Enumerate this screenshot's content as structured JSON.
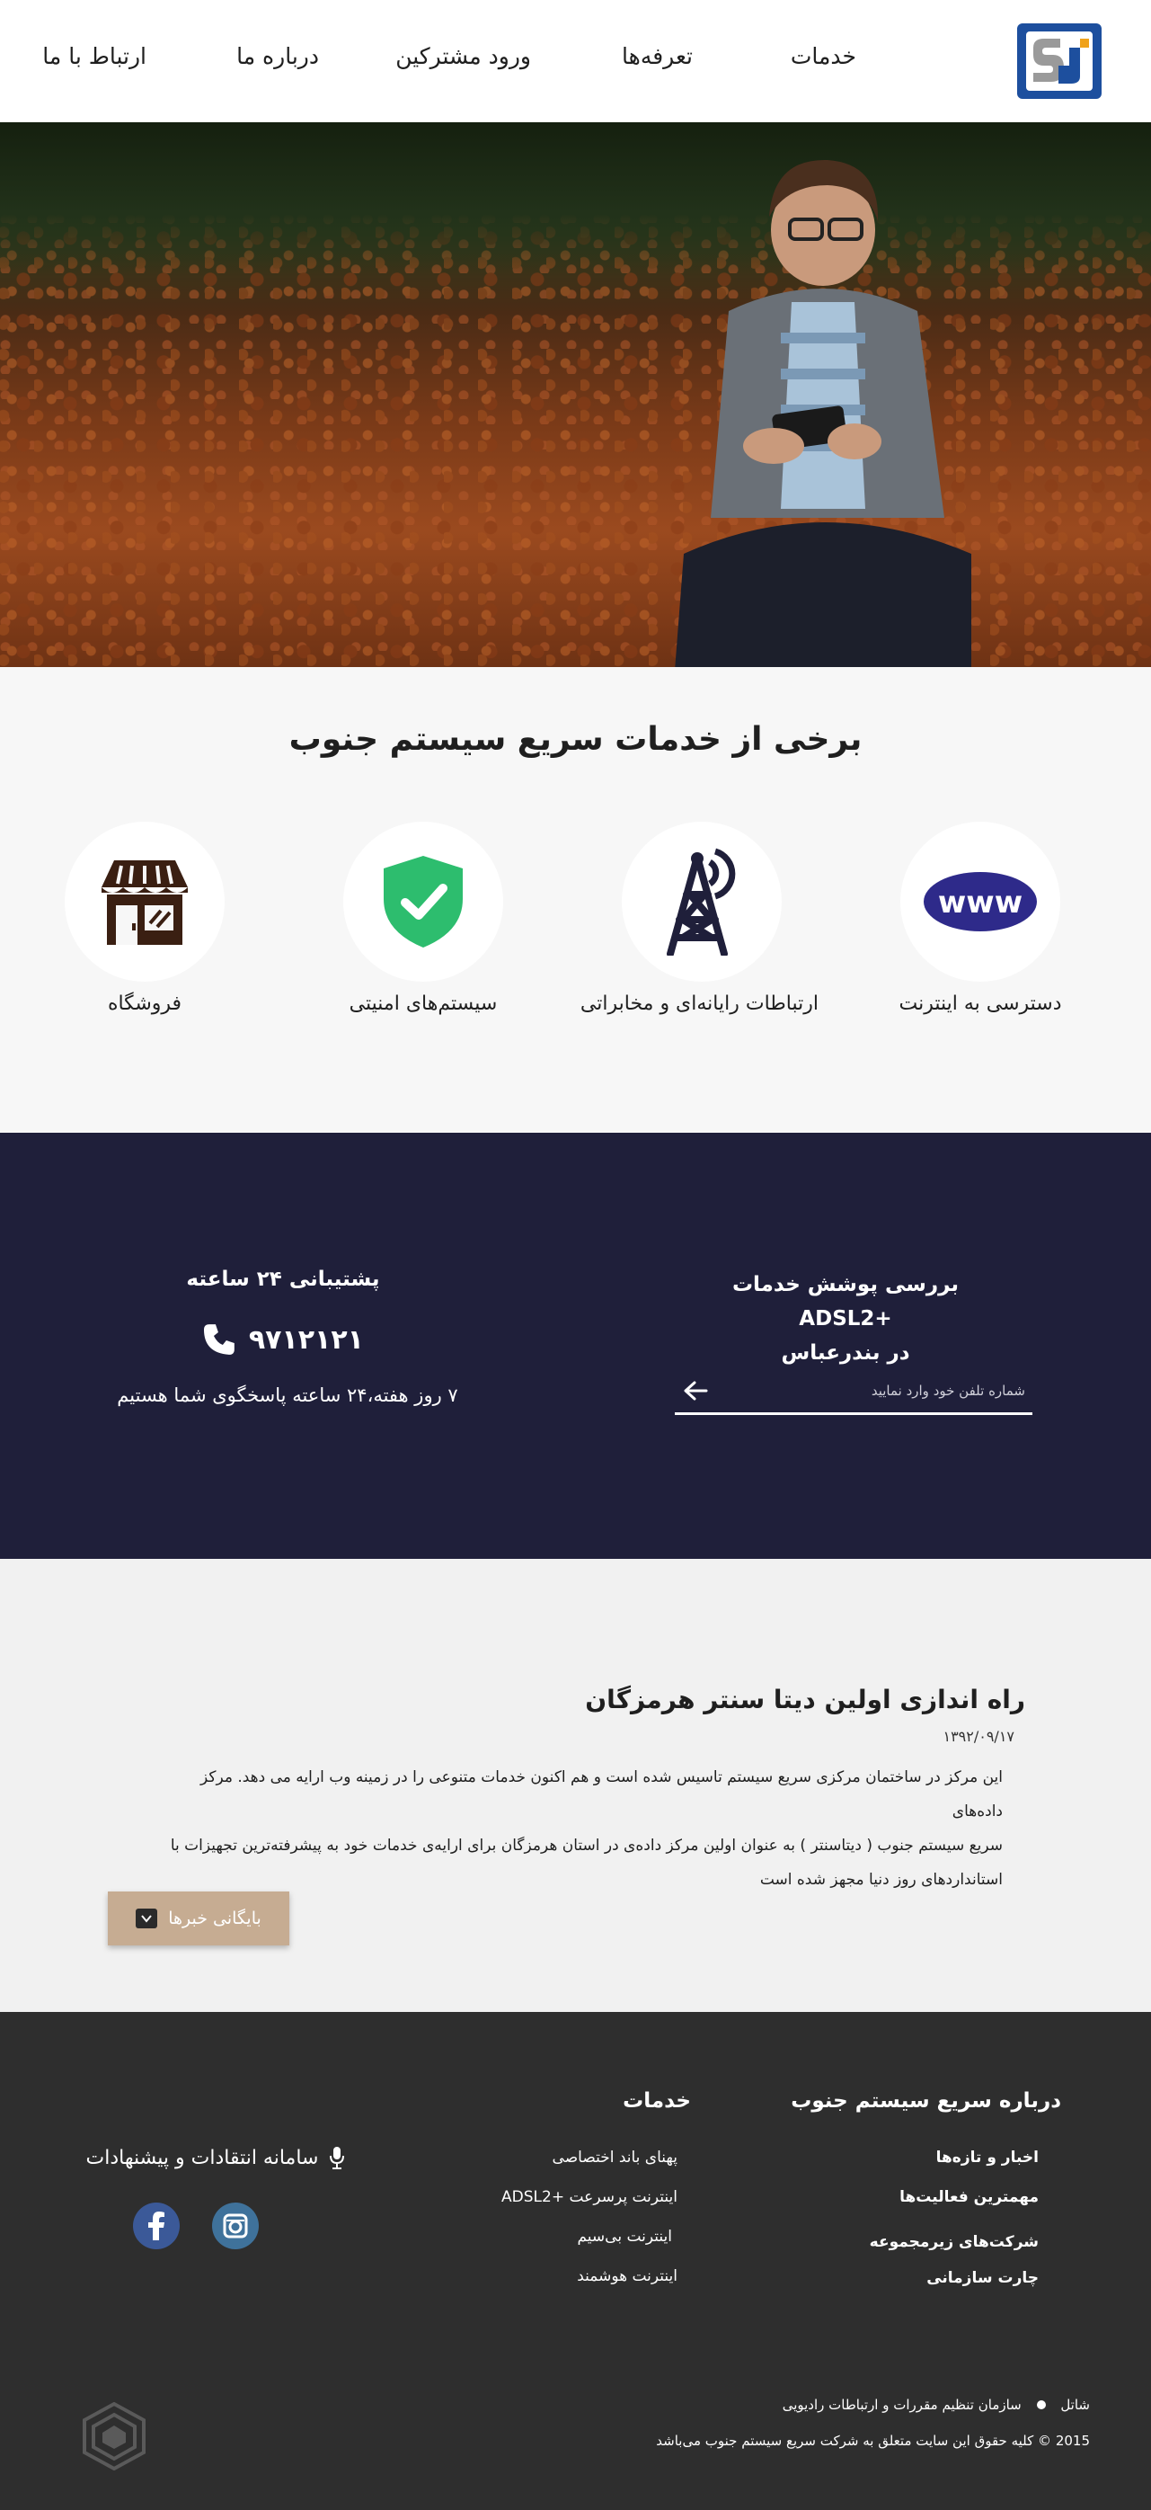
{
  "header": {
    "nav": [
      "خدمات",
      "تعرفه‌ها",
      "ورود مشترکین",
      "درباره ما",
      "ارتباط با ما"
    ]
  },
  "services": {
    "title": "برخی از خدمات سریع سیستم جنوب",
    "items": [
      {
        "label": "دسترسی به اینترنت",
        "icon": "www-globe-icon"
      },
      {
        "label": "ارتباطات رایانه‌ای و مخابراتی",
        "icon": "antenna-tower-icon"
      },
      {
        "label": "سیستم‌های امنیتی",
        "icon": "shield-check-icon"
      },
      {
        "label": "فروشگاه",
        "icon": "shop-icon"
      }
    ],
    "www_text": "www"
  },
  "coverage": {
    "title_line1": "بررسی پوشش خدمات +ADSL2",
    "title_line2": "در بندرعباس",
    "input_placeholder": "شماره تلفن خود وارد نمایید"
  },
  "support": {
    "title": "پشتیبانی ۲۴ ساعته",
    "phone": "۹۷۱۲۱۲۱",
    "note": "۷ روز هفته،۲۴ ساعته پاسخگوی شما هستیم"
  },
  "news": {
    "title": "راه اندازی اولین دیتا سنتر هرمزگان",
    "date": "۱۳۹۲/۰۹/۱۷",
    "body_lines": [
      "این مرکز در ساختمان مرکزی سریع سیستم تاسیس شده است و هم اکنون خدمات متنوعی را در زمینه وب ارایه می دهد. مرکز داده‌های",
      "سریع سیستم جنوب ( دیتاسنتر ) به عنوان اولین مرکز داده‌ی در استان هرمزگان برای ارایه‌ی خدمات خود به پیشرفته‌ترین تجهیزات با",
      "استانداردهای روز دنیا مجهز شده است"
    ],
    "archive_label": "بایگانی خبرها"
  },
  "footer": {
    "about_title": "درباره سریع سیستم جنوب",
    "about_links": [
      "اخبار و تازه‌ها",
      "مهمترین فعالیت‌ها",
      "شرکت‌های زیرمجموعه",
      "چارت سازمانی"
    ],
    "services_title": "خدمات",
    "services_links": [
      "پهنای باند اختصاصی",
      "اینترنت پرسرعت +ADSL2",
      "اینترنت بی‌سیم",
      "اینترنت هوشمند"
    ],
    "feedback_label": "سامانه انتقادات و پیشنهادات",
    "shatel_label": "شاتل",
    "regulator_label": "سازمان تنظیم مقررات و ارتباطات رادیویی",
    "copyright": "2015 © کلیه حقوق این سایت متعلق به شرکت سریع سیستم جنوب می‌باشد"
  },
  "colors": {
    "brand_blue": "#1d4f9e",
    "dark_band": "#1f1f3a",
    "footer_bg": "#2e2e2e",
    "archive_button": "#c6ac92",
    "shield_green": "#2dbd6e",
    "www_blue": "#2e2a8a",
    "facebook_blue": "#3b5998",
    "instagram_blue": "#3f729b"
  }
}
